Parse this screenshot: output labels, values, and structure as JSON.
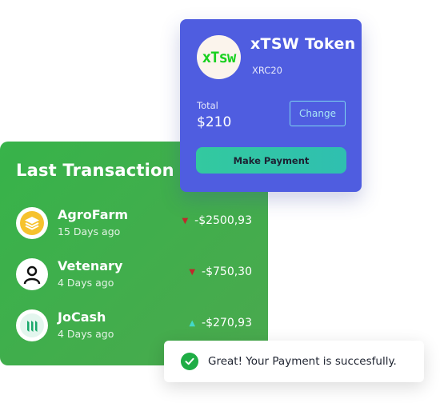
{
  "transactions": {
    "title": "Last Transaction",
    "items": [
      {
        "name": "AgroFarm",
        "date": "15 Days ago",
        "amount": "-$2500,93",
        "trend": "down",
        "icon": "stacked-layers-icon"
      },
      {
        "name": "Vetenary",
        "date": "4 Days ago",
        "amount": "-$750,30",
        "trend": "down",
        "icon": "person-icon"
      },
      {
        "name": "JoCash",
        "date": "4 Days ago",
        "amount": "-$270,93",
        "trend": "up",
        "icon": "stripes-icon"
      }
    ]
  },
  "token": {
    "logo_text": "xTsw",
    "name": "xTSW Token",
    "standard": "XRC20",
    "total_label": "Total",
    "total_value": "$210",
    "change_label": "Change",
    "pay_label": "Make Payment"
  },
  "toast": {
    "message": "Great! Your Payment is succesfully."
  },
  "colors": {
    "transaction_card": "#37b34a",
    "token_card": "#4f5de0",
    "pay_button": "#33c99f",
    "trend_down": "#c0282b",
    "trend_up": "#43d9c9",
    "success": "#1fad45"
  }
}
